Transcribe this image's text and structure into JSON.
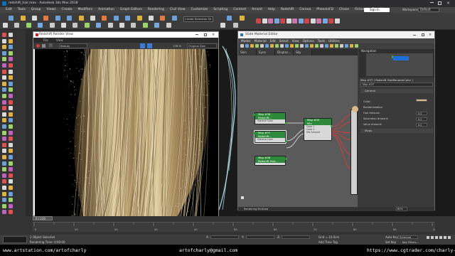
{
  "window": {
    "title": "redshift_hair.max - Autodesk 3ds Max 2018"
  },
  "app_menu": [
    "Edit",
    "Tools",
    "Group",
    "Views",
    "Create",
    "Modifiers",
    "Animation",
    "Graph Editors",
    "Rendering",
    "Civil View",
    "Customize",
    "Scripting",
    "Content",
    "Arnold",
    "Help",
    "Redshift",
    "Corona",
    "PhoenixFD",
    "Chaos",
    "Octane",
    "DeadMe"
  ],
  "account": {
    "sign_in": "Sign In",
    "workspaces": "Workspaces:",
    "workspace_value": "Default"
  },
  "toolbar": {
    "selection_set": "Create Selection Se"
  },
  "render_view": {
    "title": "Redshift Render View",
    "menu": [
      "File",
      "View"
    ],
    "preset": "Beauty",
    "zoom": "176 %",
    "view_mode": "Original Size"
  },
  "sme": {
    "title": "Slate Material Editor",
    "menu": [
      "Modes",
      "Material",
      "Edit",
      "Select",
      "View",
      "Options",
      "Tools",
      "Utilities"
    ],
    "tabs": [
      "Skin",
      "Eyes",
      "Displac...",
      "Sky"
    ],
    "navigation_label": "Navigation",
    "props_header": "Map #37  ( Redshift HairRandomColor )",
    "props_sub": "Map #37",
    "rollout_general": "General",
    "rollout_maps": "Maps",
    "props": [
      {
        "label": "General",
        "value": ""
      },
      {
        "label": "Color:",
        "value": ""
      },
      {
        "label": "Randomization",
        "value": ""
      },
      {
        "label": "Hue Amount:",
        "value": "0.0"
      },
      {
        "label": "Saturation Amount:",
        "value": "0.0"
      },
      {
        "label": "Value Amount:",
        "value": "0.0"
      }
    ],
    "nodes": [
      {
        "title": "Map #36",
        "sub": "Redshift...",
        "port": "General Color"
      },
      {
        "title": "Map #37",
        "sub": "Redshift...",
        "port": "General Color"
      },
      {
        "title": "Map #38",
        "sub": "Redshift Hair...",
        "port": ""
      },
      {
        "title": "Map #33",
        "sub": "Mix",
        "port": ""
      }
    ],
    "mix_ports": [
      "Color 1",
      "Color 2",
      "Mix Amount"
    ],
    "status": "Rendering Finished",
    "view_tab": "View1",
    "zoom": "80%"
  },
  "timeline": {
    "frame": "0 / 100"
  },
  "status": {
    "objects": "1 Object Selected",
    "rendering_time": "Rendering Time: 0:00:00",
    "grid": "Grid = 10.0cm",
    "add_time_tag": "Add Time Tag",
    "auto_key": "Auto Key",
    "selected": "Selected",
    "set_key": "Set Key",
    "key_filters": "Key Filters...",
    "coord_x": "X:",
    "coord_y": "Y:",
    "coord_z": "Z:"
  },
  "footer": {
    "left": "www.artstation.com/artofcharly",
    "center": "artofcharly@gmail.com",
    "right": "https://www.cgtrader.com/charly-l"
  }
}
